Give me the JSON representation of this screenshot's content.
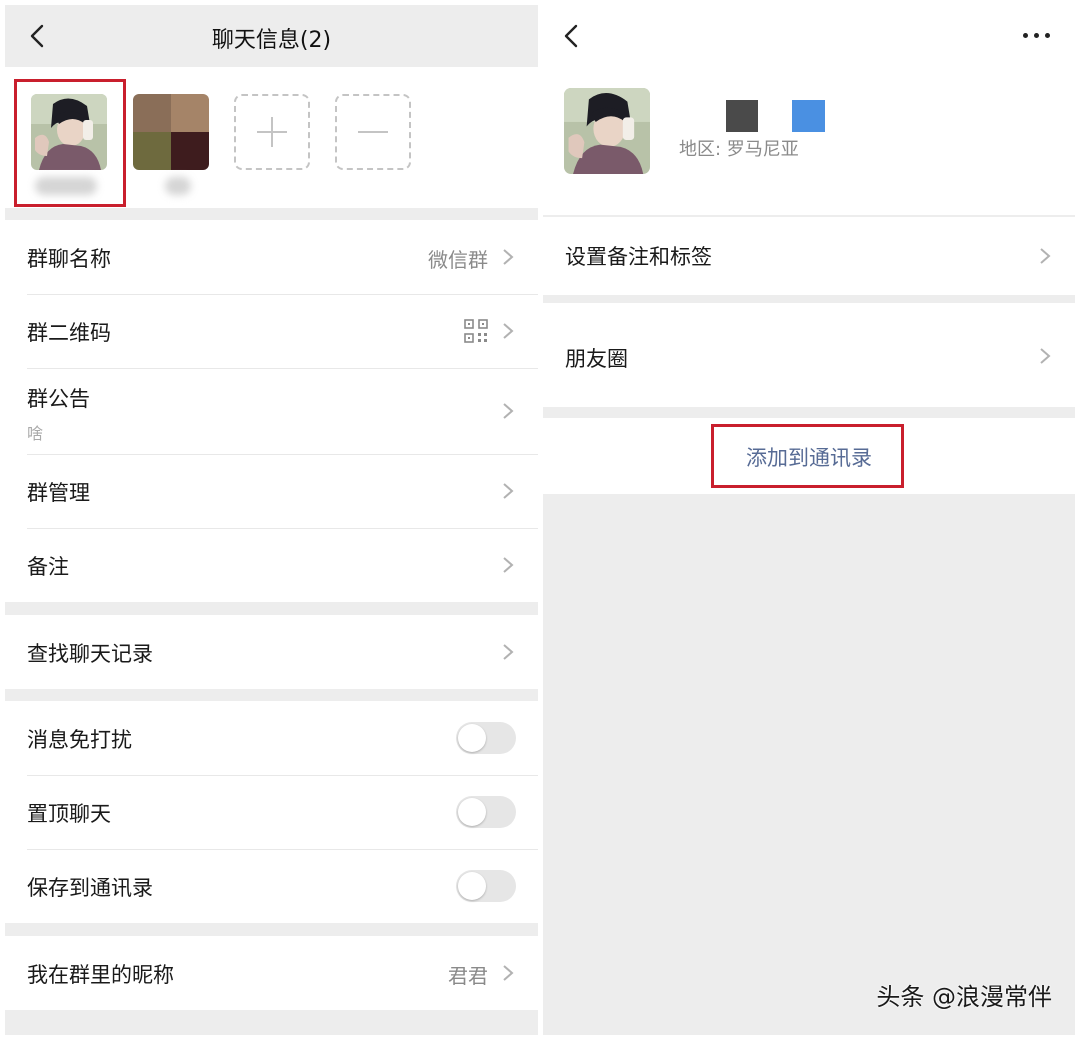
{
  "left": {
    "header": {
      "title": "聊天信息(2)"
    },
    "members": {
      "add_icon": "plus-icon",
      "remove_icon": "minus-icon"
    },
    "group_info": [
      {
        "label": "群聊名称",
        "value": "微信群"
      },
      {
        "label": "群二维码",
        "icon": "qr-code-icon"
      },
      {
        "label": "群公告",
        "sub": "啥"
      },
      {
        "label": "群管理"
      },
      {
        "label": "备注"
      }
    ],
    "search": {
      "label": "查找聊天记录"
    },
    "toggles": [
      {
        "label": "消息免打扰",
        "on": false
      },
      {
        "label": "置顶聊天",
        "on": false
      },
      {
        "label": "保存到通讯录",
        "on": false
      }
    ],
    "nickname": {
      "label": "我在群里的昵称",
      "value": "君君"
    }
  },
  "right": {
    "profile": {
      "region": "地区: 罗马尼亚",
      "nickname_colors": [
        "#4a4a4a",
        "#4a90e2"
      ]
    },
    "remark": {
      "label": "设置备注和标签"
    },
    "moments": {
      "label": "朋友圈"
    },
    "add_contact": {
      "label": "添加到通讯录"
    }
  },
  "watermark": "头条 @浪漫常伴",
  "colors": {
    "highlight": "#c91f2d",
    "link": "#576b95",
    "background": "#ededed"
  }
}
